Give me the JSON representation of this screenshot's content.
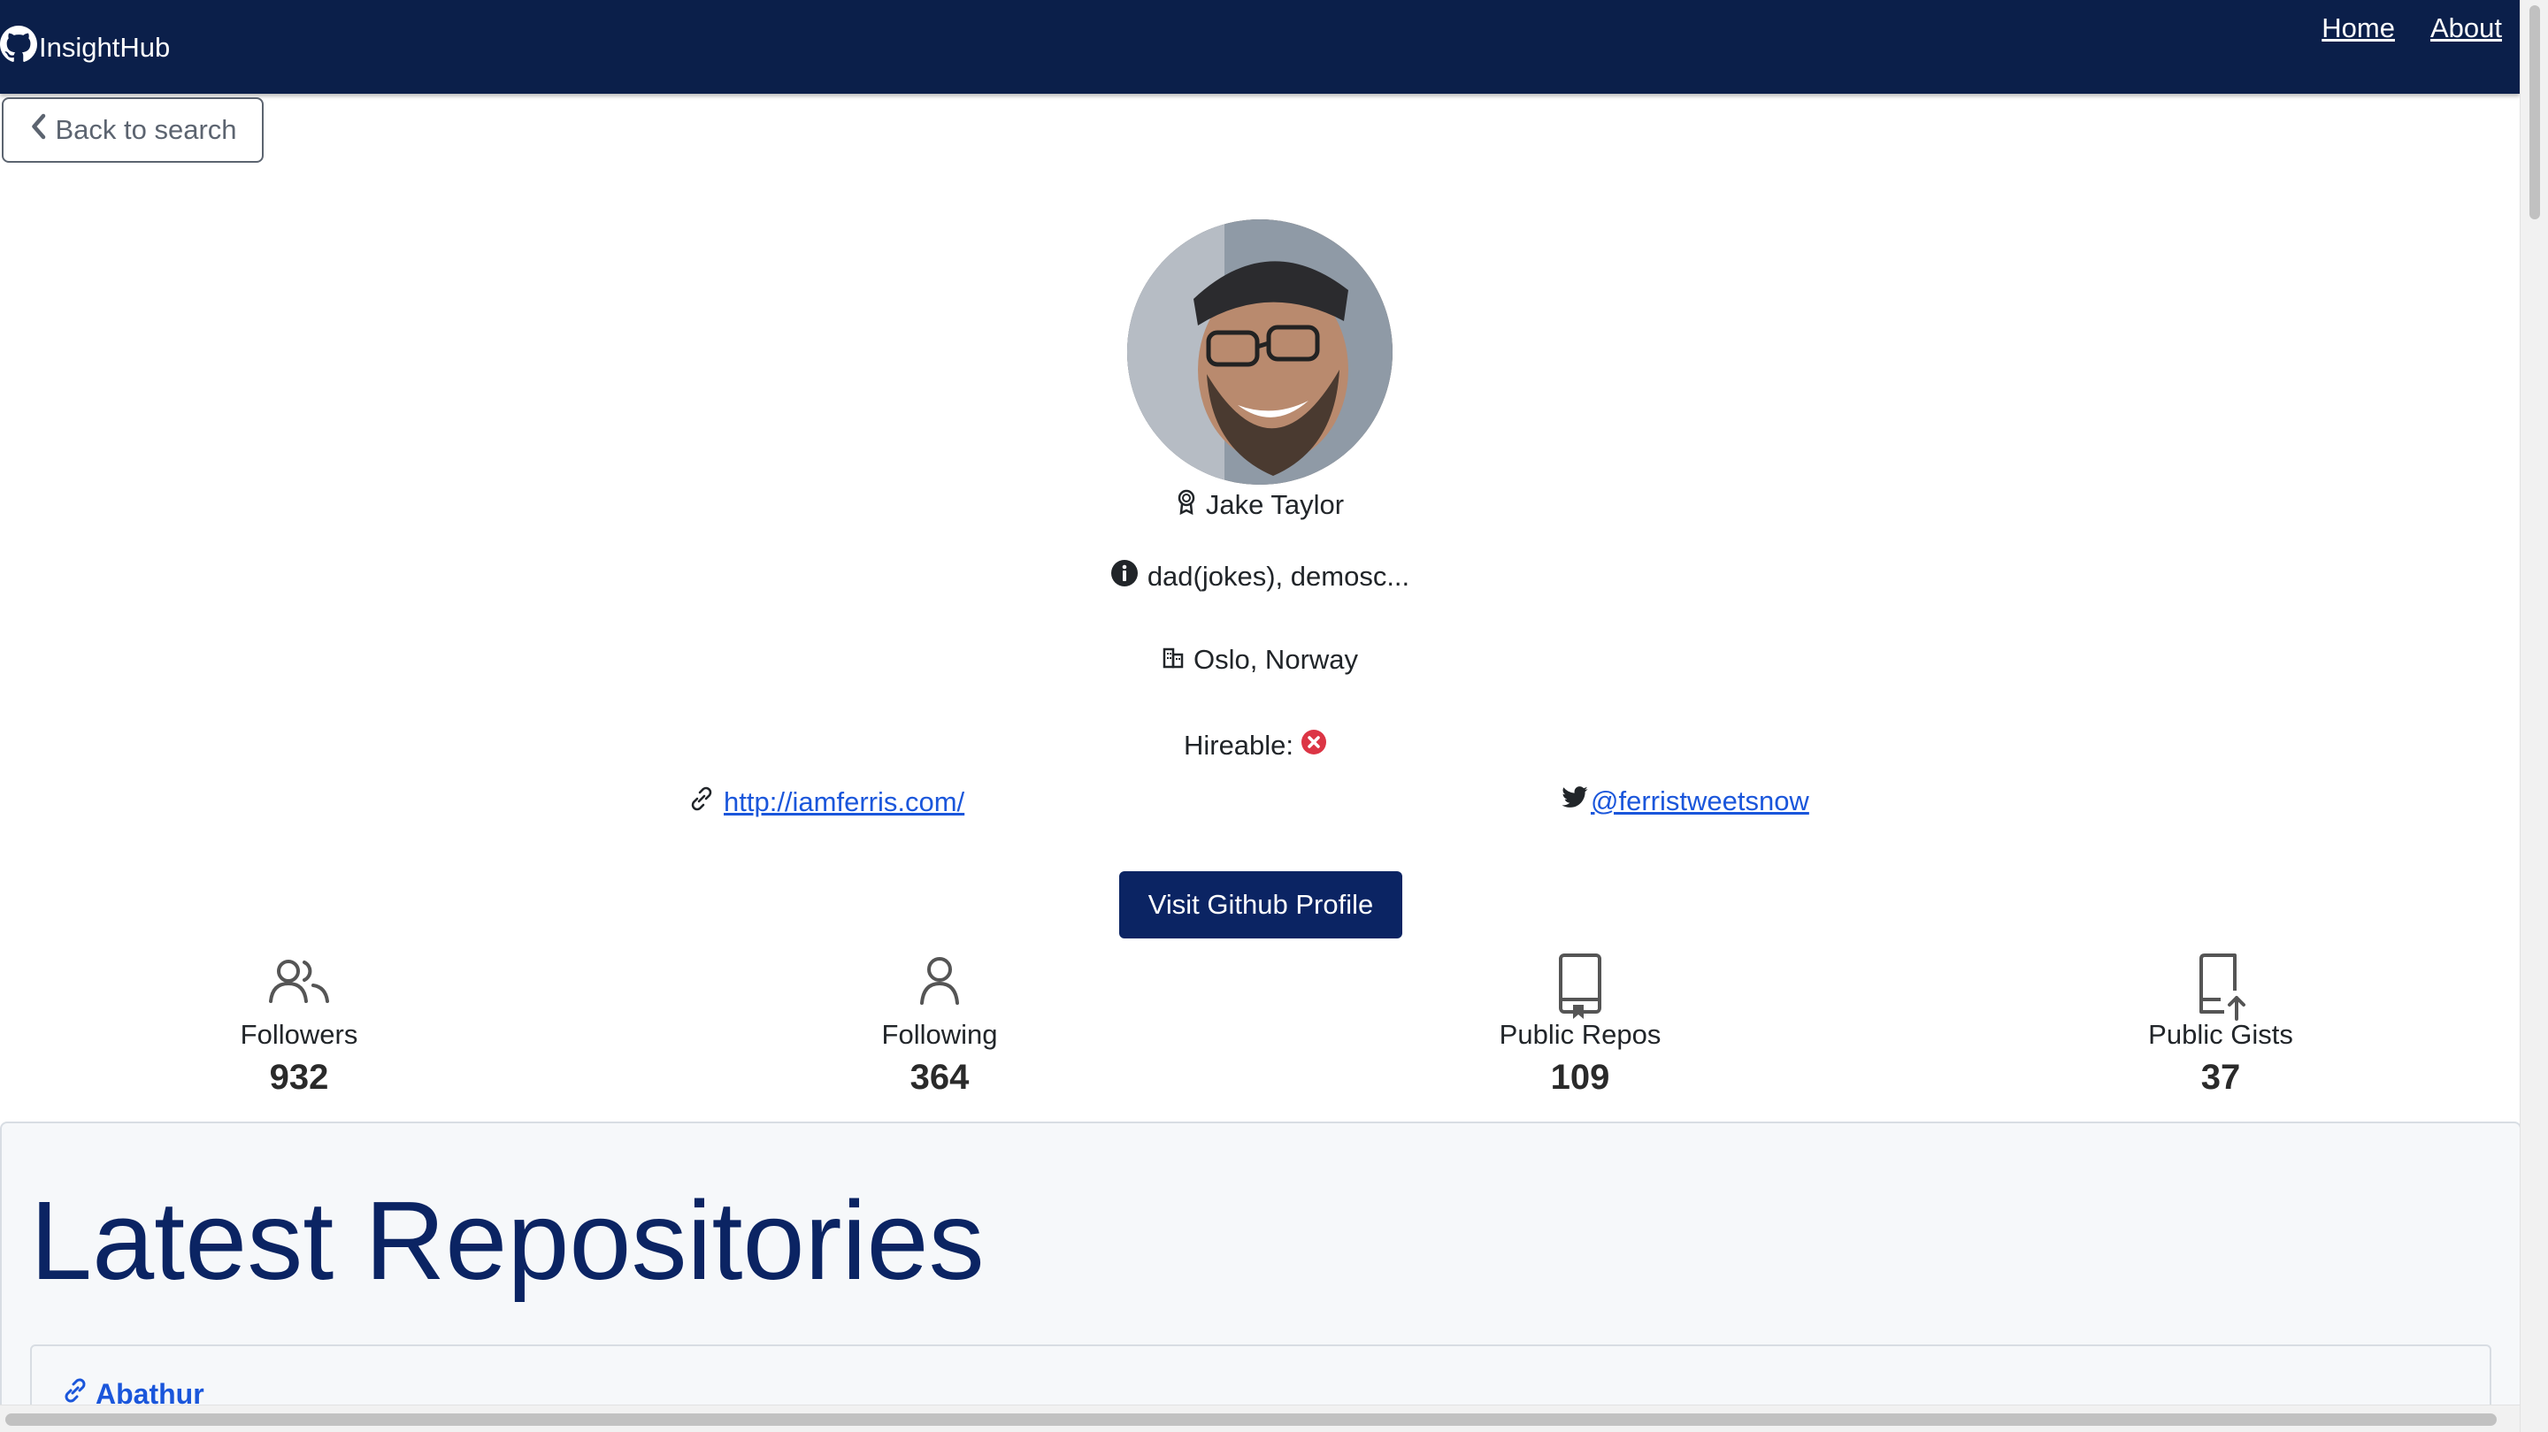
{
  "navbar": {
    "brand": "InsightHub",
    "links": [
      {
        "label": "Home"
      },
      {
        "label": "About"
      }
    ]
  },
  "back_button": {
    "label": "Back to search"
  },
  "profile": {
    "name": "Jake Taylor",
    "bio": "dad(jokes), demosc...",
    "location": "Oslo, Norway",
    "hireable_label": "Hireable:",
    "hireable": false,
    "blog": "http://iamferris.com/",
    "twitter": "@ferristweetsnow",
    "github_button": "Visit Github Profile"
  },
  "stats": [
    {
      "label": "Followers",
      "value": "932",
      "icon": "followers-icon"
    },
    {
      "label": "Following",
      "value": "364",
      "icon": "person-icon"
    },
    {
      "label": "Public Repos",
      "value": "109",
      "icon": "repo-icon"
    },
    {
      "label": "Public Gists",
      "value": "37",
      "icon": "gist-icon"
    }
  ],
  "repositories": {
    "title": "Latest Repositories",
    "items": [
      {
        "name": "Abathur"
      }
    ]
  },
  "colors": {
    "navbar": "#0b1f4a",
    "accent": "#0b2463",
    "link": "#1a56db",
    "danger": "#dc3545"
  }
}
